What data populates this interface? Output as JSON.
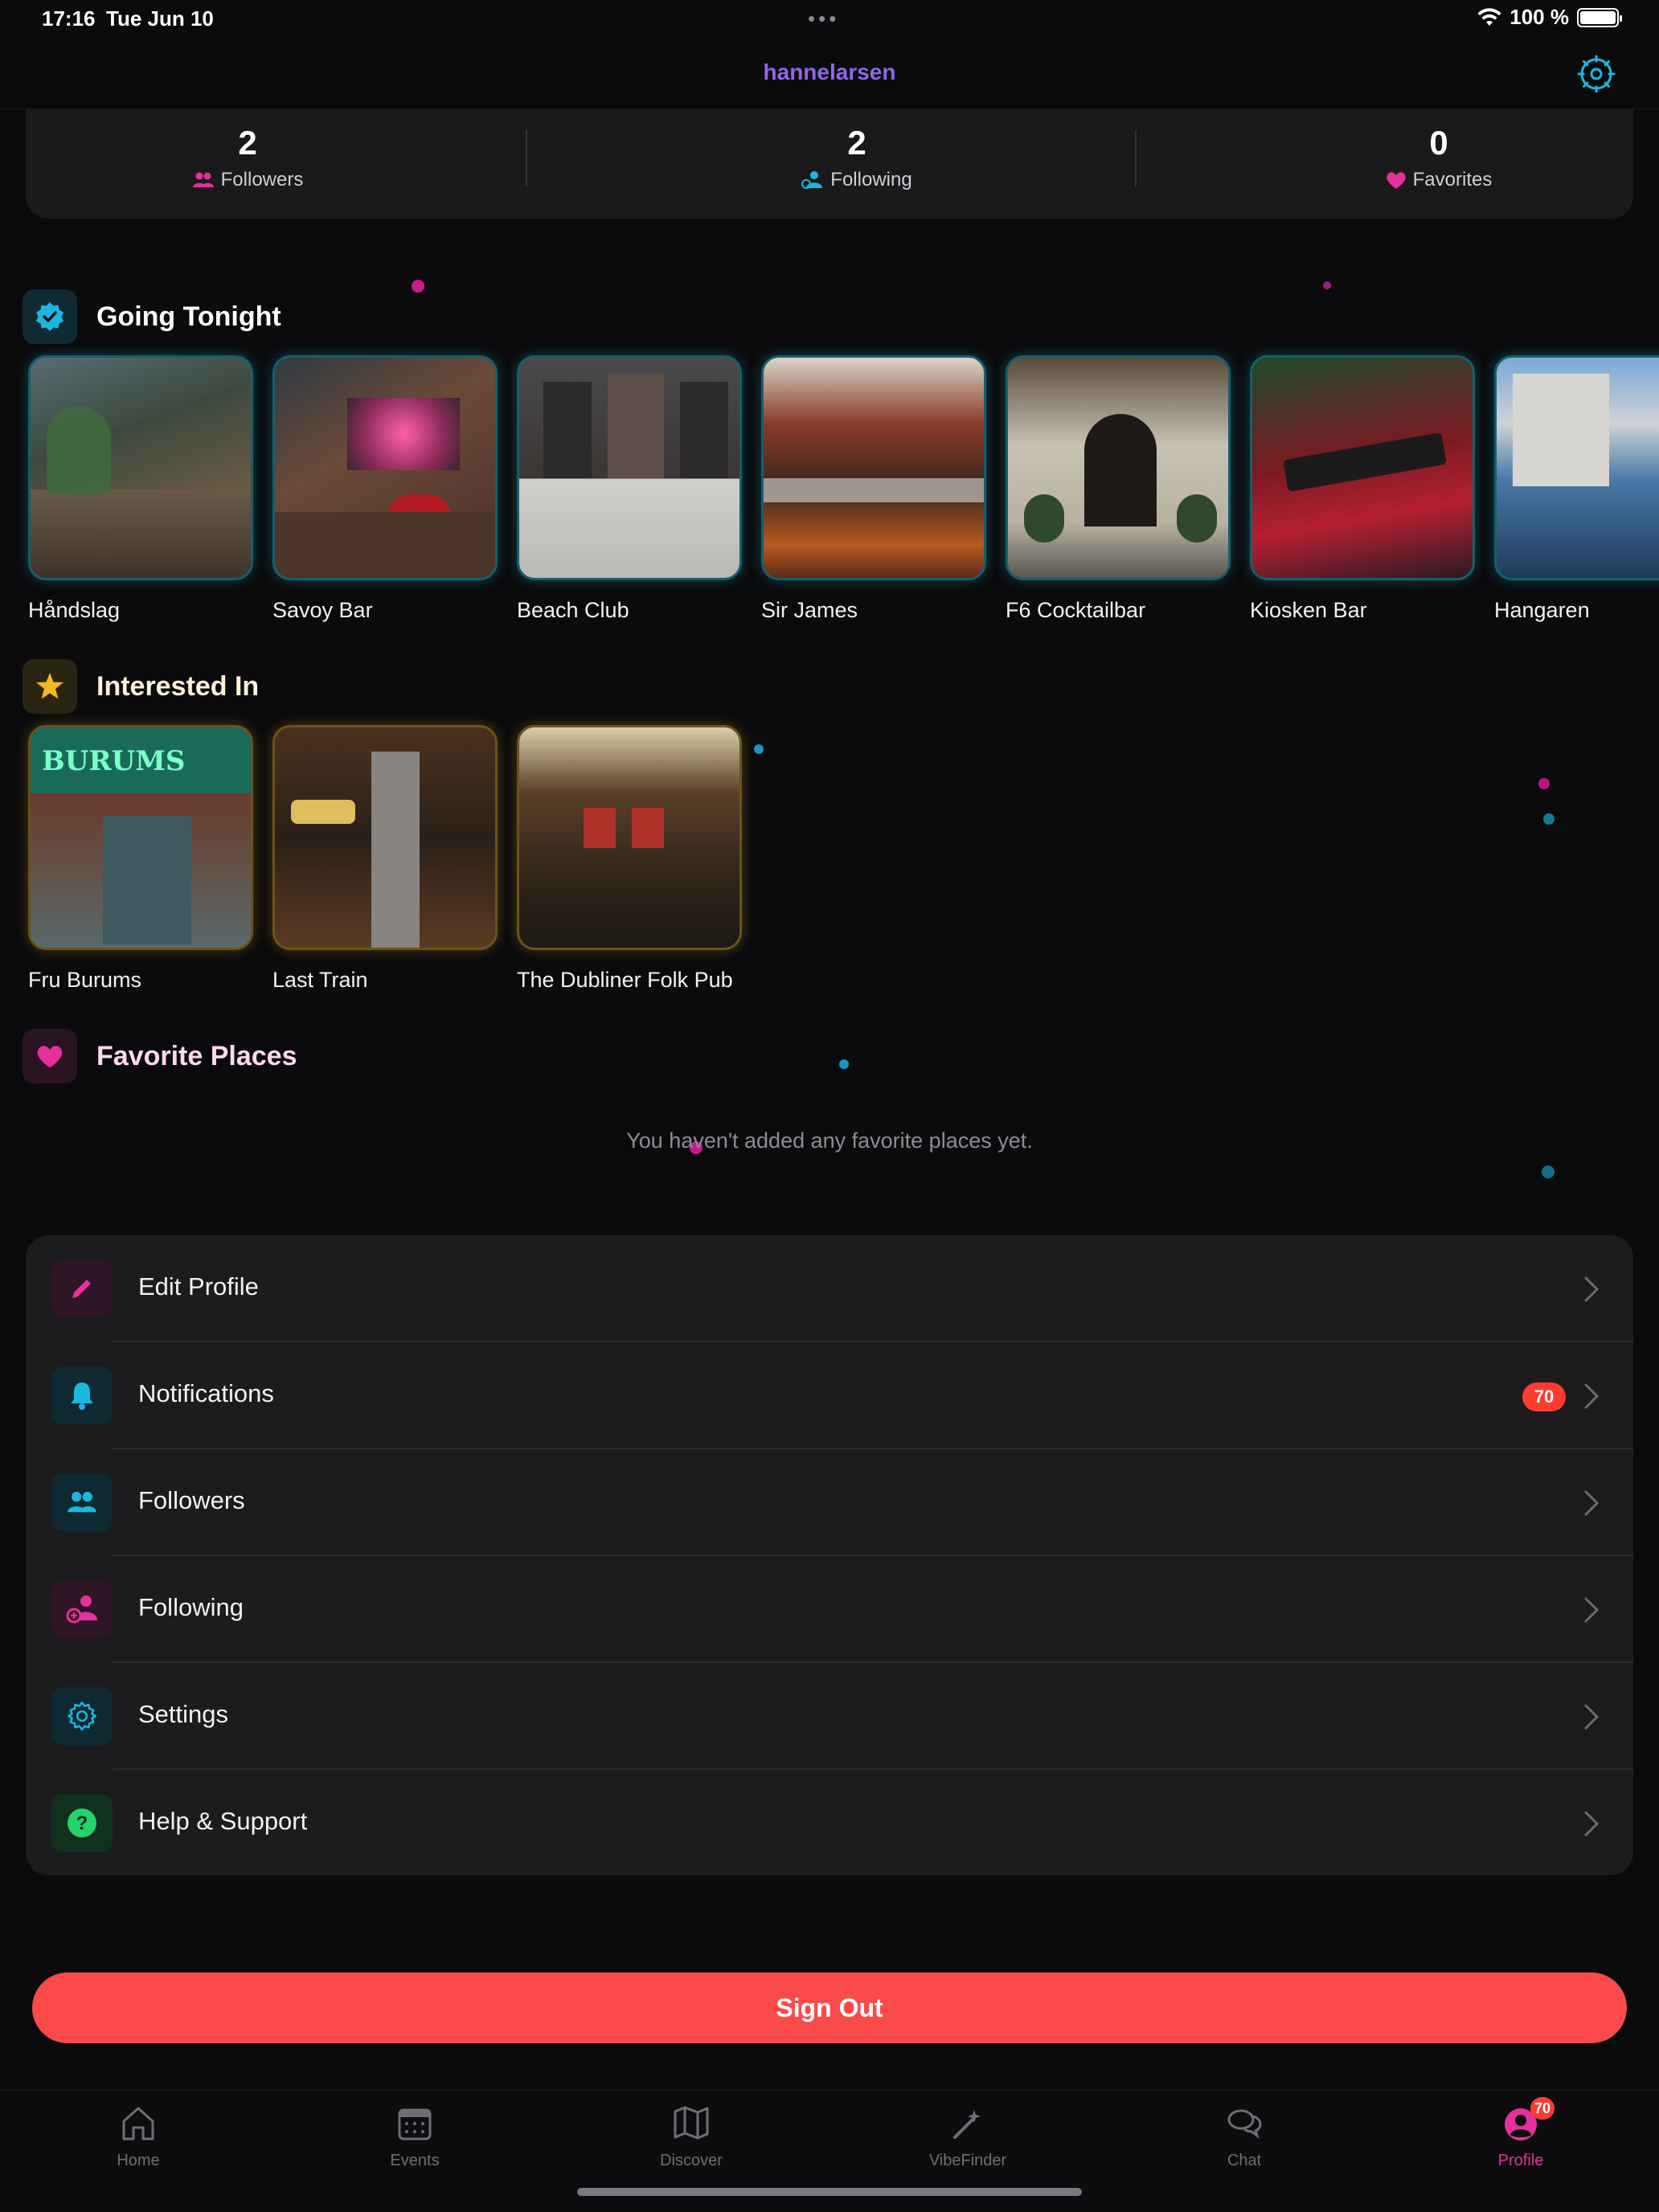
{
  "status_bar": {
    "time": "17:16",
    "date": "Tue Jun 10",
    "dots": "•••",
    "battery": "100 %",
    "battery_level": 1.0
  },
  "header": {
    "username": "hannelarsen",
    "settings_icon": "gear-icon"
  },
  "stats": [
    {
      "value": "2",
      "label": "Followers",
      "icon": "people-icon"
    },
    {
      "value": "2",
      "label": "Following",
      "icon": "person-follow-icon"
    },
    {
      "value": "0",
      "label": "Favorites",
      "icon": "heart-icon"
    }
  ],
  "going_tonight": {
    "title": "Going Tonight",
    "venues": [
      "Håndslag",
      "Savoy Bar",
      "Beach Club",
      "Sir James",
      "F6 Cocktailbar",
      "Kiosken Bar",
      "Hangaren"
    ]
  },
  "interested_in": {
    "title": "Interested In",
    "venues": [
      "Fru Burums",
      "Last Train",
      "The Dubliner Folk Pub"
    ]
  },
  "favorite_places": {
    "title": "Favorite Places",
    "empty_text": "You haven't added any favorite places yet."
  },
  "menu": [
    {
      "label": "Edit Profile",
      "icon": "pencil-icon",
      "color": "#e6309c"
    },
    {
      "label": "Notifications",
      "icon": "bell-icon",
      "color": "#1ab8e0",
      "badge": "70"
    },
    {
      "label": "Followers",
      "icon": "people-icon",
      "color": "#1ab8e0"
    },
    {
      "label": "Following",
      "icon": "person-add-icon",
      "color": "#e6309c"
    },
    {
      "label": "Settings",
      "icon": "gear-icon",
      "color": "#1ab8e0"
    },
    {
      "label": "Help & Support",
      "icon": "help-icon",
      "color": "#24d36b"
    }
  ],
  "sign_out": "Sign Out",
  "tabs": [
    {
      "label": "Home",
      "icon": "house-icon"
    },
    {
      "label": "Events",
      "icon": "calendar-icon"
    },
    {
      "label": "Discover",
      "icon": "map-icon"
    },
    {
      "label": "VibeFinder",
      "icon": "wand-icon"
    },
    {
      "label": "Chat",
      "icon": "chat-bubbles-icon"
    },
    {
      "label": "Profile",
      "icon": "profile-icon",
      "badge": "70",
      "active": true
    }
  ],
  "colors": {
    "accent_pink": "#e6309c",
    "accent_cyan": "#1ab8e0",
    "danger": "#fa4a4a",
    "gold": "#f5b81d"
  }
}
